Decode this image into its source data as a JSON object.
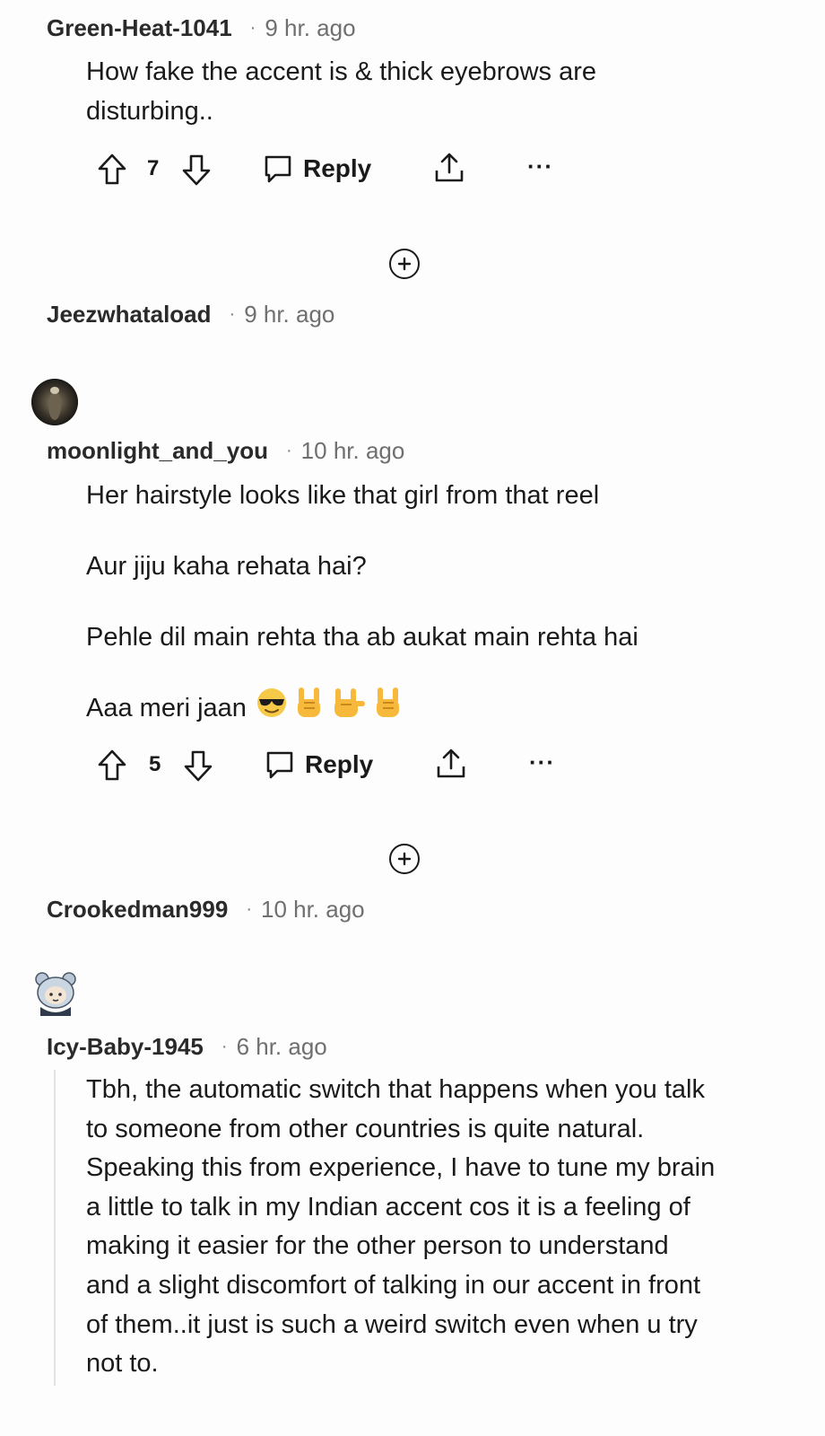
{
  "comments": [
    {
      "user": "Green-Heat-1041",
      "separator": "·",
      "time": "9 hr. ago",
      "body": [
        "How fake the accent is & thick eyebrows are",
        "disturbing.."
      ],
      "score": "7",
      "reply_label": "Reply",
      "more_label": "···"
    },
    {
      "user": "Jeezwhataload",
      "separator": "·",
      "time": "9 hr. ago"
    },
    {
      "user": "moonlight_and_you",
      "separator": "·",
      "time": "10 hr. ago",
      "paragraphs": [
        "Her hairstyle looks like that girl from that reel",
        "Aur jiju kaha rehata hai?",
        "Pehle dil main rehta tha ab aukat main rehta hai",
        "Aaa meri jaan"
      ],
      "emojis": [
        "sunglasses-face",
        "sign-of-the-horns",
        "love-you-gesture",
        "sign-of-the-horns"
      ],
      "score": "5",
      "reply_label": "Reply",
      "more_label": "···"
    },
    {
      "user": "Crookedman999",
      "separator": "·",
      "time": "10 hr. ago"
    },
    {
      "user": "Icy-Baby-1945",
      "separator": "·",
      "time": "6 hr. ago",
      "body": [
        "Tbh, the automatic switch that happens when you talk",
        "to someone from other countries is quite natural.",
        "Speaking this from experience, I have to tune my brain",
        "a little to talk in my Indian accent cos it is a feeling of",
        "making it easier for the other person to understand",
        "and a slight discomfort of talking in our accent in front",
        "of them..it just is such a weird switch even when u try",
        "not to."
      ]
    }
  ],
  "icons": {
    "upvote": "upvote-arrow-icon",
    "downvote": "downvote-arrow-icon",
    "reply": "comment-bubble-icon",
    "share": "share-icon",
    "expand": "plus-circle-icon"
  },
  "colors": {
    "text": "#1c1c1c",
    "meta": "#6f6f6f",
    "thread_line": "#e3e3e3"
  }
}
